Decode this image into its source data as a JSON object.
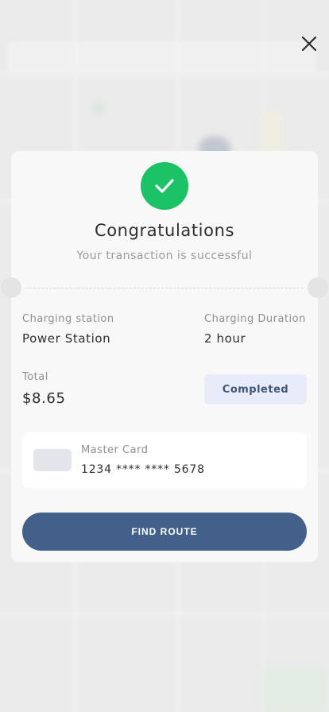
{
  "header": {
    "close_icon": "close-icon"
  },
  "receipt": {
    "status_icon": "check-circle-icon",
    "title": "Congratulations",
    "subtitle": "Your transaction is successful",
    "station_label": "Charging station",
    "station_value": "Power Station",
    "duration_label": "Charging Duration",
    "duration_value": "2 hour",
    "total_label": "Total",
    "total_value": "$8.65",
    "status_badge": "Completed",
    "payment": {
      "card_icon": "credit-card-icon",
      "card_name": "Master Card",
      "card_number": "1234 **** **** 5678"
    },
    "action_button": "FIND ROUTE"
  },
  "colors": {
    "success": "#1bc266",
    "primary": "#42608a",
    "badge_bg": "#e8ebf9",
    "badge_text": "#40557a"
  }
}
